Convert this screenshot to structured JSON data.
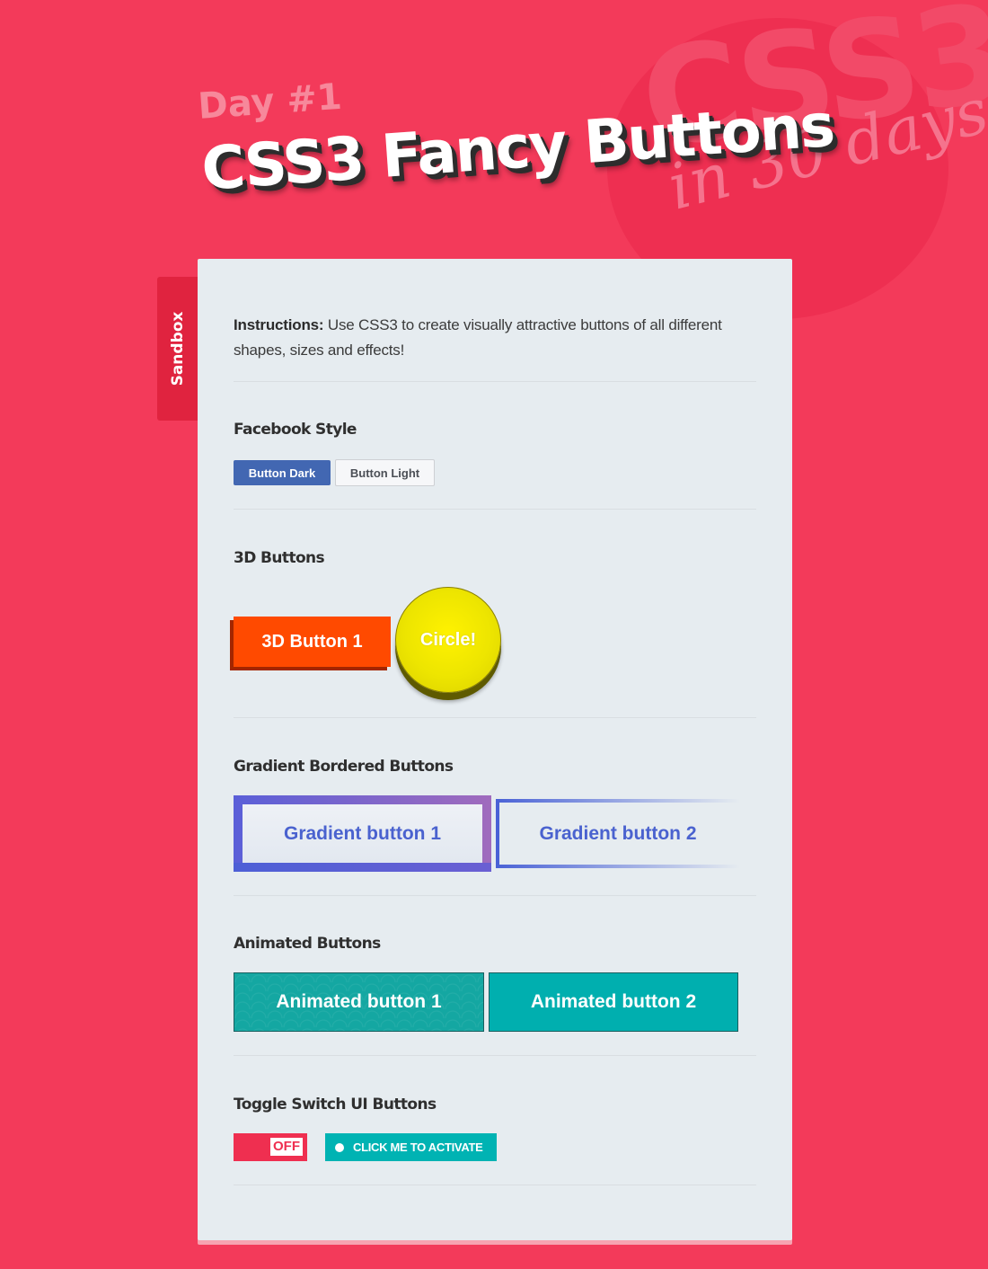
{
  "header": {
    "badge_top": "CSS3",
    "badge_bottom": "in 30 days",
    "day_label": "Day #1",
    "title": "CSS3 Fancy Buttons"
  },
  "side_tab": {
    "label": "Sandbox"
  },
  "instructions": {
    "prefix": "Instructions:",
    "text": " Use CSS3 to create visually attractive buttons of all different shapes, sizes and effects!"
  },
  "sections": {
    "facebook": {
      "title": "Facebook Style",
      "dark_label": "Button Dark",
      "light_label": "Button Light"
    },
    "three_d": {
      "title": "3D Buttons",
      "button_label": "3D Button 1",
      "circle_label": "Circle!"
    },
    "gradient": {
      "title": "Gradient Bordered Buttons",
      "button1_label": "Gradient button 1",
      "button2_label": "Gradient button 2"
    },
    "animated": {
      "title": "Animated Buttons",
      "button1_label": "Animated button 1",
      "button2_label": "Animated button 2"
    },
    "toggle": {
      "title": "Toggle Switch UI Buttons",
      "switch_state": "OFF",
      "activate_label": "CLICK ME TO ACTIVATE"
    }
  },
  "colors": {
    "background": "#f33a5a",
    "panel": "#e6ecf0",
    "facebook_blue": "#4267b2",
    "orange": "#ff4a00",
    "yellow": "#ede500",
    "teal": "#00afaf",
    "gradient_blue": "#4a62cf"
  }
}
